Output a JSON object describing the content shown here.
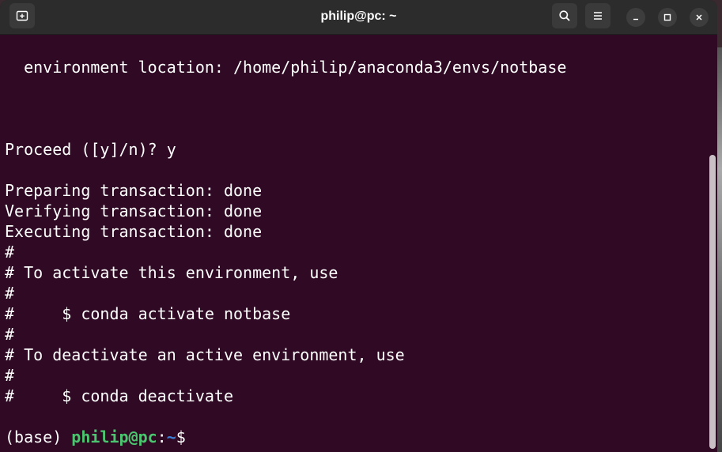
{
  "window": {
    "title": "philip@pc: ~"
  },
  "terminal": {
    "lines": [
      "  environment location: /home/philip/anaconda3/envs/notbase",
      "Proceed ([y]/n)? y",
      "Preparing transaction: done",
      "Verifying transaction: done",
      "Executing transaction: done",
      "#",
      "# To activate this environment, use",
      "#",
      "#     $ conda activate notbase",
      "#",
      "# To deactivate an active environment, use",
      "#",
      "#     $ conda deactivate"
    ],
    "prompt": {
      "env": "(base) ",
      "user_host": "philip@pc",
      "colon": ":",
      "path": "~",
      "symbol": "$"
    }
  },
  "colors": {
    "background": "#300a24",
    "text": "#ffffff",
    "prompt_user": "#4bc56f",
    "prompt_path": "#3c80d8",
    "titlebar": "#2c2c2c"
  },
  "icons": {
    "new_tab": "new-tab-icon",
    "search": "search-icon",
    "menu": "hamburger-menu-icon",
    "minimize": "minimize-icon",
    "maximize": "maximize-icon",
    "close": "close-icon"
  }
}
